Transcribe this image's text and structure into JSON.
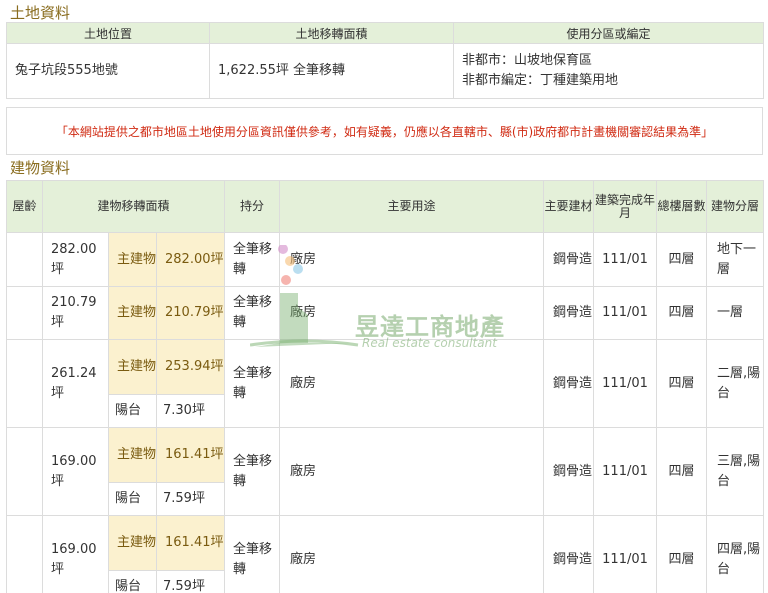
{
  "land": {
    "title": "土地資料",
    "headers": [
      "土地位置",
      "土地移轉面積",
      "使用分區或編定"
    ],
    "location": "兔子坑段555地號",
    "area": "1,622.55坪 全筆移轉",
    "zoning_1": "非都市：山坡地保育區",
    "zoning_2": "非都市編定：丁種建築用地"
  },
  "notice": "「本網站提供之都市地區土地使用分區資訊僅供參考，如有疑義，仍應以各直轄市、縣(市)政府都市計畫機關審認結果為準」",
  "building": {
    "title": "建物資料",
    "headers": {
      "age": "屋齡",
      "area": "建物移轉面積",
      "holding": "持分",
      "use": "主要用途",
      "material": "主要建材",
      "completed": "建築完成年月",
      "total_floors": "總樓層數",
      "floor": "建物分層"
    },
    "rows": [
      {
        "age": "",
        "area": "282.00坪",
        "main_label": "主建物",
        "main_area": "282.00坪",
        "holding": "全筆移轉",
        "use": "廠房",
        "material": "鋼骨造",
        "completed": "111/01",
        "total_floors": "四層",
        "floor": "地下一層"
      },
      {
        "age": "",
        "area": "210.79坪",
        "main_label": "主建物",
        "main_area": "210.79坪",
        "holding": "全筆移轉",
        "use": "廠房",
        "material": "鋼骨造",
        "completed": "111/01",
        "total_floors": "四層",
        "floor": "一層"
      },
      {
        "age": "",
        "area": "261.24坪",
        "main_label": "主建物",
        "main_area": "253.94坪",
        "balcony_label": "陽台",
        "balcony_area": "7.30坪",
        "holding": "全筆移轉",
        "use": "廠房",
        "material": "鋼骨造",
        "completed": "111/01",
        "total_floors": "四層",
        "floor": "二層,陽台"
      },
      {
        "age": "",
        "area": "169.00坪",
        "main_label": "主建物",
        "main_area": "161.41坪",
        "balcony_label": "陽台",
        "balcony_area": "7.59坪",
        "holding": "全筆移轉",
        "use": "廠房",
        "material": "鋼骨造",
        "completed": "111/01",
        "total_floors": "四層",
        "floor": "三層,陽台"
      },
      {
        "age": "",
        "area": "169.00坪",
        "main_label": "主建物",
        "main_area": "161.41坪",
        "balcony_label": "陽台",
        "balcony_area": "7.59坪",
        "holding": "全筆移轉",
        "use": "廠房",
        "material": "鋼骨造",
        "completed": "111/01",
        "total_floors": "四層",
        "floor": "四層,陽台"
      }
    ]
  },
  "watermark": {
    "name": "昱達工商地產",
    "tagline": "Real estate consultant"
  },
  "colors": {
    "section_title": "#8a6d1f",
    "header_bg": "#e4f0d9",
    "notice_text": "#d02a12",
    "main_cell_bg": "#fbf1cf"
  }
}
